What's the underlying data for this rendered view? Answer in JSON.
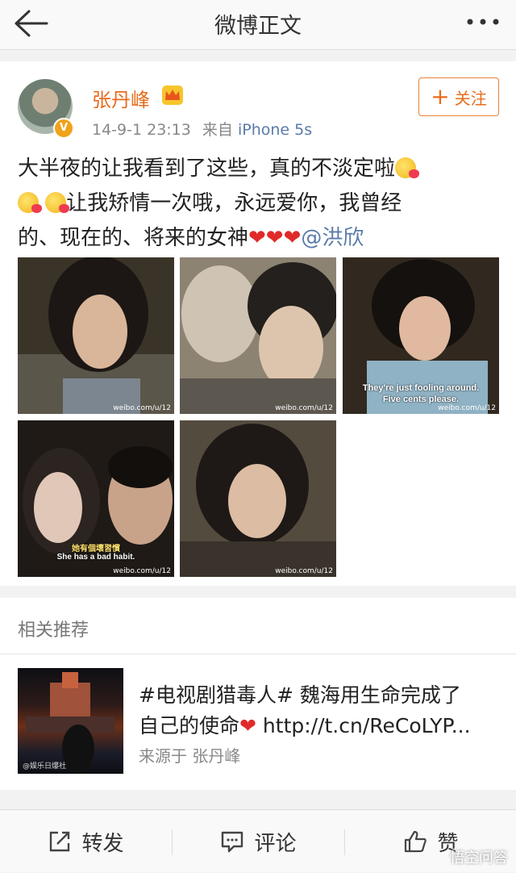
{
  "topbar": {
    "title": "微博正文"
  },
  "post": {
    "author": "张丹峰",
    "verified_badge": "V",
    "time": "14-9-1 23:13",
    "source_prefix": "来自",
    "source": "iPhone 5s",
    "follow_label": "关注",
    "text_line1": "大半夜的让我看到了这些，真的不淡定啦",
    "text_line2": "让我矫情一次哦，永远爱你，我曾经",
    "text_line3": "的、现在的、将来的女神",
    "hearts": "❤❤❤",
    "mention": "@洪欣",
    "photos": [
      {
        "watermark": "weibo.com/u/12",
        "subtitle": ""
      },
      {
        "watermark": "weibo.com/u/12",
        "subtitle": ""
      },
      {
        "watermark": "weibo.com/u/12",
        "subtitle1": "They're just fooling around.",
        "subtitle2": "Five cents please."
      },
      {
        "watermark": "weibo.com/u/12",
        "subtitle1": "她有個壞習慣",
        "subtitle2": "She has a bad habit."
      },
      {
        "watermark": "weibo.com/u/12",
        "subtitle": ""
      }
    ]
  },
  "related": {
    "title": "相关推荐",
    "item_text_line1": "#电视剧猎毒人# 魏海用生命完成了",
    "item_text_line2": "自己的使命",
    "item_heart": "❤",
    "item_link": "http://t.cn/ReCoLYP...",
    "item_source": "来源于 张丹峰",
    "thumb_watermark": "@娱乐日爆社"
  },
  "bottom": {
    "repost": "转发",
    "comment": "评论",
    "like": "赞",
    "watermark": "悟空问答"
  },
  "colors": {
    "accent": "#e86b1c",
    "link": "#5a7ba9",
    "heart": "#e02a2a"
  }
}
